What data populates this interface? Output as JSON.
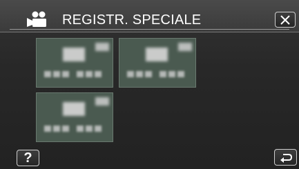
{
  "header": {
    "title": "REGISTR. SPECIALE",
    "mode_icon": "movie-camera-icon",
    "close_icon": "close-icon"
  },
  "tiles": [
    {
      "name": "effect-option-1"
    },
    {
      "name": "effect-option-2"
    },
    {
      "name": "effect-option-3"
    }
  ],
  "footer": {
    "help_label": "?",
    "back_icon": "return-arrow-icon"
  }
}
